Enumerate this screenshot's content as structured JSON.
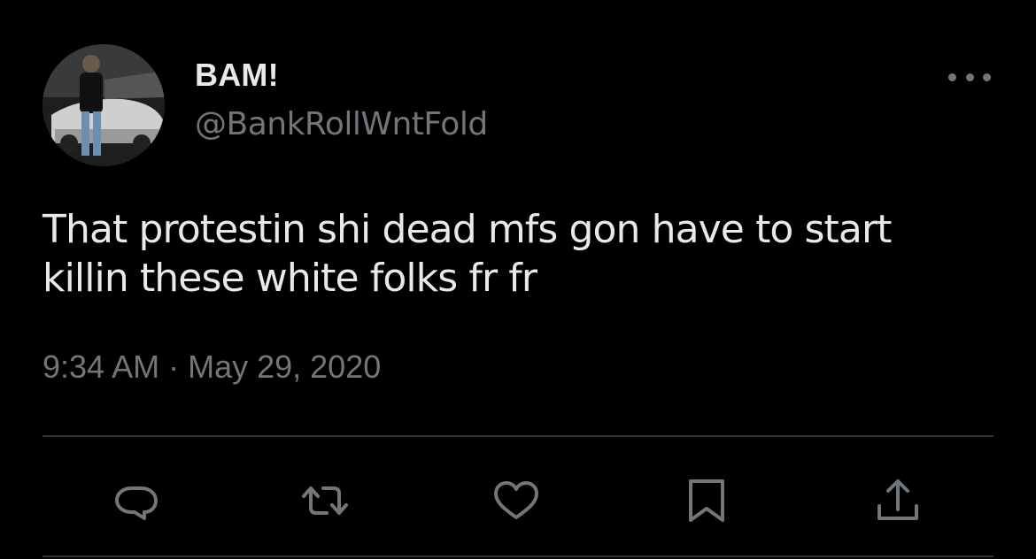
{
  "tweet": {
    "author": {
      "display_name": "BAM!",
      "handle": "@BankRollWntFold",
      "avatar_icon": "profile-avatar"
    },
    "text": "That protestin shi dead mfs gon have to start\nkillin these white folks fr fr",
    "time": "9:34 AM",
    "separator": "·",
    "date": "May 29, 2020"
  },
  "actions": {
    "reply_icon": "reply-icon",
    "retweet_icon": "retweet-icon",
    "like_icon": "like-icon",
    "bookmark_icon": "bookmark-icon",
    "share_icon": "share-icon"
  },
  "colors": {
    "background": "#000000",
    "primary_text": "#e7e9ea",
    "secondary_text": "#71767b",
    "divider": "#2f3336"
  }
}
